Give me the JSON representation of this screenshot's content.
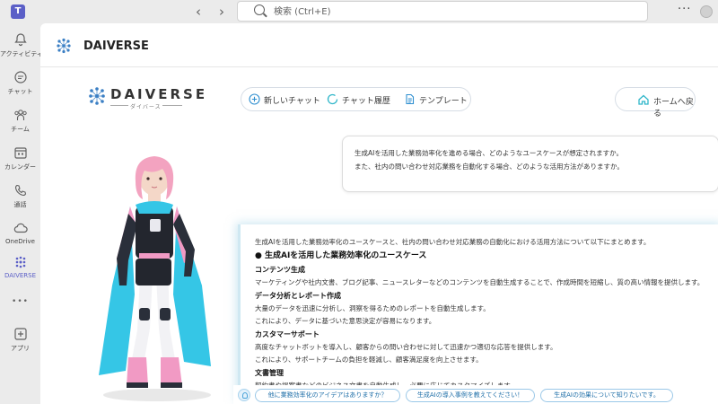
{
  "topbar": {
    "search_placeholder": "検索 (Ctrl+E)",
    "back_icon": "chevron-left-icon",
    "forward_icon": "chevron-right-icon",
    "more": "···"
  },
  "rail": {
    "items": [
      {
        "label": "アクティビティ",
        "icon": "bell-icon"
      },
      {
        "label": "チャット",
        "icon": "chat-icon"
      },
      {
        "label": "チーム",
        "icon": "people-icon"
      },
      {
        "label": "カレンダー",
        "icon": "calendar-icon"
      },
      {
        "label": "通話",
        "icon": "phone-icon"
      },
      {
        "label": "OneDrive",
        "icon": "cloud-icon"
      },
      {
        "label": "DAIVERSE",
        "icon": "daiverse-icon"
      },
      {
        "label": "•••",
        "icon": "more-icon"
      },
      {
        "label": "アプリ",
        "icon": "add-app-icon"
      }
    ]
  },
  "app": {
    "title": "DAIVERSE"
  },
  "brand": {
    "name": "DAIVERSE",
    "subtitle": "ダイバース"
  },
  "toolbar": {
    "new_chat": "新しいチャット",
    "history": "チャット履歴",
    "template": "テンプレート",
    "home": "ホームへ戻る"
  },
  "question": {
    "line1": "生成AIを活用した業務効率化を進める場合、どのようなユースケースが想定されますか。",
    "line2": "また、社内の問い合わせ対応業務を自動化する場合、どのような活用方法がありますか。"
  },
  "answer": {
    "intro": "生成AIを活用した業務効率化のユースケースと、社内の問い合わせ対応業務の自動化における活用方法について以下にまとめます。",
    "heading": "● 生成AIを活用した業務効率化のユースケース",
    "sections": [
      {
        "title": "コンテンツ生成",
        "lines": [
          "マーケティングや社内文書、ブログ記事、ニュースレターなどのコンテンツを自動生成することで、作成時間を短縮し、質の高い情報を提供します。"
        ]
      },
      {
        "title": "データ分析とレポート作成",
        "lines": [
          "大量のデータを迅速に分析し、洞察を得るためのレポートを自動生成します。",
          "これにより、データに基づいた意思決定が容易になります。"
        ]
      },
      {
        "title": "カスタマーサポート",
        "lines": [
          "高度なチャットボットを導入し、顧客からの問い合わせに対して迅速かつ適切な応答を提供します。",
          "これにより、サポートチームの負担を軽減し、顧客満足度を向上させます。"
        ]
      },
      {
        "title": "文書管理",
        "lines": [
          "契約書や提案書などのビジネス文書を自動生成し、必要に応じてカスタマイズします。"
        ]
      }
    ]
  },
  "suggestions": [
    "他に業務効率化のアイデアはありますか？",
    "生成AIの導入事例を教えてください！",
    "生成AIの効果について知りたいです。"
  ],
  "colors": {
    "accent": "#5b5fc7",
    "brand_blue": "#3b7fc4",
    "chip_border": "#9bc8e8",
    "chip_text": "#1f6fa8"
  }
}
